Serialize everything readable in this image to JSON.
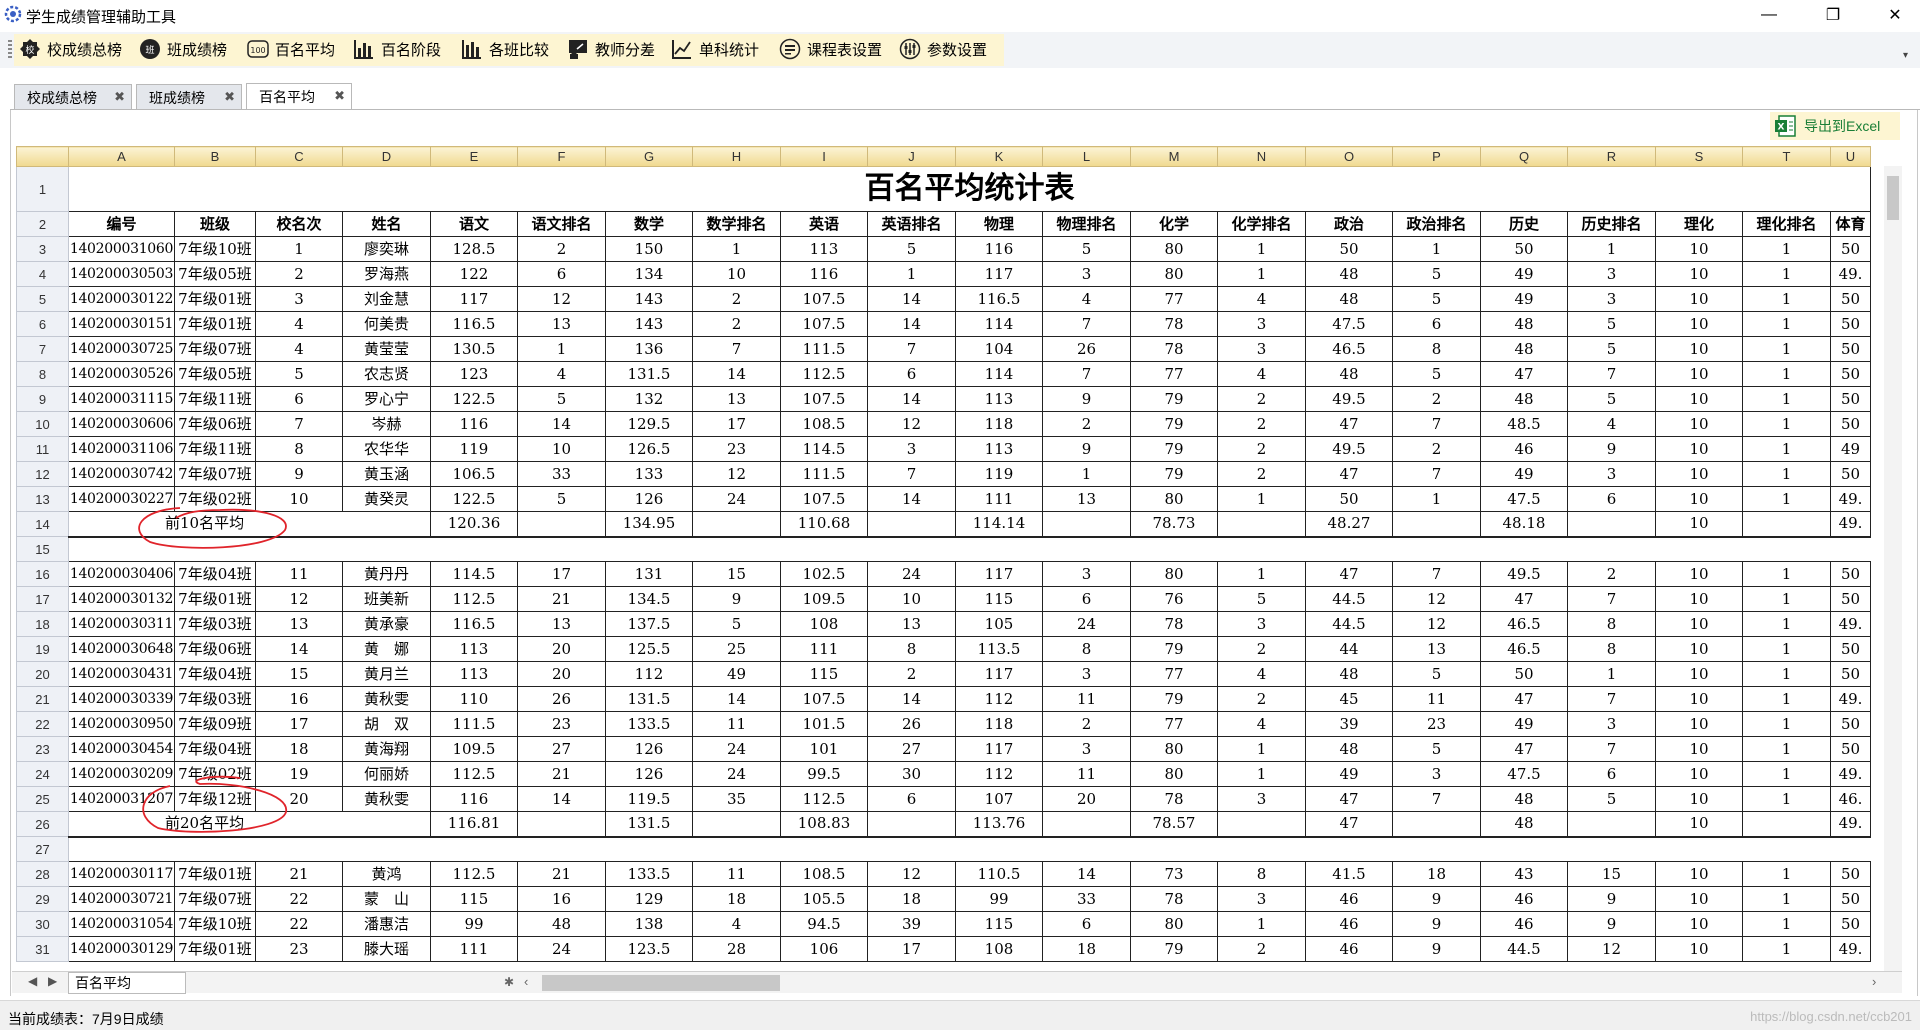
{
  "app": {
    "title": "学生成绩管理辅助工具",
    "window_controls": [
      "—",
      "❐",
      "✕"
    ]
  },
  "toolbar": {
    "buttons": [
      {
        "label": "校成绩总榜",
        "icon": "school-badge-icon"
      },
      {
        "label": "班成绩榜",
        "icon": "class-badge-icon"
      },
      {
        "label": "百名平均",
        "icon": "hundred-badge-icon"
      },
      {
        "label": "百名阶段",
        "icon": "bar-chart-icon"
      },
      {
        "label": "各班比较",
        "icon": "bar-chart-icon"
      },
      {
        "label": "教师分差",
        "icon": "teacher-icon"
      },
      {
        "label": "单科统计",
        "icon": "line-chart-icon"
      },
      {
        "label": "课程表设置",
        "icon": "schedule-icon"
      },
      {
        "label": "参数设置",
        "icon": "sliders-icon"
      }
    ]
  },
  "tabs": [
    {
      "label": "校成绩总榜",
      "close": "✖",
      "active": false
    },
    {
      "label": "班成绩榜",
      "close": "✖",
      "active": false
    },
    {
      "label": "百名平均",
      "close": "✖",
      "active": true
    }
  ],
  "export_button": {
    "label": "导出到Excel"
  },
  "sheet": {
    "column_letters": [
      "A",
      "B",
      "C",
      "D",
      "E",
      "F",
      "G",
      "H",
      "I",
      "J",
      "K",
      "L",
      "M",
      "N",
      "O",
      "P",
      "Q",
      "R",
      "S",
      "T",
      "U"
    ],
    "title": "百名平均统计表",
    "headers": [
      "编号",
      "班级",
      "校名次",
      "姓名",
      "语文",
      "语文排名",
      "数学",
      "数学排名",
      "英语",
      "英语排名",
      "物理",
      "物理排名",
      "化学",
      "化学排名",
      "政治",
      "政治排名",
      "历史",
      "历史排名",
      "理化",
      "理化排名",
      "体育"
    ],
    "group1": [
      [
        "140200031060",
        "7年级10班",
        "1",
        "廖奕琳",
        "128.5",
        "2",
        "150",
        "1",
        "113",
        "5",
        "116",
        "5",
        "80",
        "1",
        "50",
        "1",
        "50",
        "1",
        "10",
        "1",
        "50"
      ],
      [
        "140200030503",
        "7年级05班",
        "2",
        "罗海燕",
        "122",
        "6",
        "134",
        "10",
        "116",
        "1",
        "117",
        "3",
        "80",
        "1",
        "48",
        "5",
        "49",
        "3",
        "10",
        "1",
        "49."
      ],
      [
        "140200030122",
        "7年级01班",
        "3",
        "刘金慧",
        "117",
        "12",
        "143",
        "2",
        "107.5",
        "14",
        "116.5",
        "4",
        "77",
        "4",
        "48",
        "5",
        "49",
        "3",
        "10",
        "1",
        "50"
      ],
      [
        "140200030151",
        "7年级01班",
        "4",
        "何美贵",
        "116.5",
        "13",
        "143",
        "2",
        "107.5",
        "14",
        "114",
        "7",
        "78",
        "3",
        "47.5",
        "6",
        "48",
        "5",
        "10",
        "1",
        "50"
      ],
      [
        "140200030725",
        "7年级07班",
        "4",
        "黄莹莹",
        "130.5",
        "1",
        "136",
        "7",
        "111.5",
        "7",
        "104",
        "26",
        "78",
        "3",
        "46.5",
        "8",
        "48",
        "5",
        "10",
        "1",
        "50"
      ],
      [
        "140200030526",
        "7年级05班",
        "5",
        "农志贤",
        "123",
        "4",
        "131.5",
        "14",
        "112.5",
        "6",
        "114",
        "7",
        "77",
        "4",
        "48",
        "5",
        "47",
        "7",
        "10",
        "1",
        "50"
      ],
      [
        "140200031115",
        "7年级11班",
        "6",
        "罗心宁",
        "122.5",
        "5",
        "132",
        "13",
        "107.5",
        "14",
        "113",
        "9",
        "79",
        "2",
        "49.5",
        "2",
        "48",
        "5",
        "10",
        "1",
        "50"
      ],
      [
        "140200030606",
        "7年级06班",
        "7",
        "岑赫",
        "116",
        "14",
        "129.5",
        "17",
        "108.5",
        "12",
        "118",
        "2",
        "79",
        "2",
        "47",
        "7",
        "48.5",
        "4",
        "10",
        "1",
        "50"
      ],
      [
        "140200031106",
        "7年级11班",
        "8",
        "农华华",
        "119",
        "10",
        "126.5",
        "23",
        "114.5",
        "3",
        "113",
        "9",
        "79",
        "2",
        "49.5",
        "2",
        "46",
        "9",
        "10",
        "1",
        "49"
      ],
      [
        "140200030742",
        "7年级07班",
        "9",
        "黄玉涵",
        "106.5",
        "33",
        "133",
        "12",
        "111.5",
        "7",
        "119",
        "1",
        "79",
        "2",
        "47",
        "7",
        "49",
        "3",
        "10",
        "1",
        "50"
      ],
      [
        "140200030227",
        "7年级02班",
        "10",
        "黄癸灵",
        "122.5",
        "5",
        "126",
        "24",
        "107.5",
        "14",
        "111",
        "13",
        "80",
        "1",
        "50",
        "1",
        "47.5",
        "6",
        "10",
        "1",
        "49."
      ]
    ],
    "avg1": {
      "label": "前10名平均",
      "values": [
        "120.36",
        "",
        "134.95",
        "",
        "110.68",
        "",
        "114.14",
        "",
        "78.73",
        "",
        "48.27",
        "",
        "48.18",
        "",
        "10",
        "",
        "49."
      ]
    },
    "group2": [
      [
        "140200030406",
        "7年级04班",
        "11",
        "黄丹丹",
        "114.5",
        "17",
        "131",
        "15",
        "102.5",
        "24",
        "117",
        "3",
        "80",
        "1",
        "47",
        "7",
        "49.5",
        "2",
        "10",
        "1",
        "50"
      ],
      [
        "140200030132",
        "7年级01班",
        "12",
        "班美新",
        "112.5",
        "21",
        "134.5",
        "9",
        "109.5",
        "10",
        "115",
        "6",
        "76",
        "5",
        "44.5",
        "12",
        "47",
        "7",
        "10",
        "1",
        "50"
      ],
      [
        "140200030311",
        "7年级03班",
        "13",
        "黄承豪",
        "116.5",
        "13",
        "137.5",
        "5",
        "108",
        "13",
        "105",
        "24",
        "78",
        "3",
        "44.5",
        "12",
        "46.5",
        "8",
        "10",
        "1",
        "49."
      ],
      [
        "140200030648",
        "7年级06班",
        "14",
        "黄　娜",
        "113",
        "20",
        "125.5",
        "25",
        "111",
        "8",
        "113.5",
        "8",
        "79",
        "2",
        "44",
        "13",
        "46.5",
        "8",
        "10",
        "1",
        "50"
      ],
      [
        "140200030431",
        "7年级04班",
        "15",
        "黄月兰",
        "113",
        "20",
        "112",
        "49",
        "115",
        "2",
        "117",
        "3",
        "77",
        "4",
        "48",
        "5",
        "50",
        "1",
        "10",
        "1",
        "50"
      ],
      [
        "140200030339",
        "7年级03班",
        "16",
        "黄秋雯",
        "110",
        "26",
        "131.5",
        "14",
        "107.5",
        "14",
        "112",
        "11",
        "79",
        "2",
        "45",
        "11",
        "47",
        "7",
        "10",
        "1",
        "49."
      ],
      [
        "140200030950",
        "7年级09班",
        "17",
        "胡　双",
        "111.5",
        "23",
        "133.5",
        "11",
        "101.5",
        "26",
        "118",
        "2",
        "77",
        "4",
        "39",
        "23",
        "49",
        "3",
        "10",
        "1",
        "50"
      ],
      [
        "140200030454",
        "7年级04班",
        "18",
        "黄海翔",
        "109.5",
        "27",
        "126",
        "24",
        "101",
        "27",
        "117",
        "3",
        "80",
        "1",
        "48",
        "5",
        "47",
        "7",
        "10",
        "1",
        "50"
      ],
      [
        "140200030209",
        "7年级02班",
        "19",
        "何丽娇",
        "112.5",
        "21",
        "126",
        "24",
        "99.5",
        "30",
        "112",
        "11",
        "80",
        "1",
        "49",
        "3",
        "47.5",
        "6",
        "10",
        "1",
        "49."
      ],
      [
        "140200031207",
        "7年级12班",
        "20",
        "黄秋雯",
        "116",
        "14",
        "119.5",
        "35",
        "112.5",
        "6",
        "107",
        "20",
        "78",
        "3",
        "47",
        "7",
        "48",
        "5",
        "10",
        "1",
        "46."
      ]
    ],
    "avg2": {
      "label": "前20名平均",
      "values": [
        "116.81",
        "",
        "131.5",
        "",
        "108.83",
        "",
        "113.76",
        "",
        "78.57",
        "",
        "47",
        "",
        "48",
        "",
        "10",
        "",
        "49."
      ]
    },
    "group3": [
      [
        "140200030117",
        "7年级01班",
        "21",
        "黄鸿",
        "112.5",
        "21",
        "133.5",
        "11",
        "108.5",
        "12",
        "110.5",
        "14",
        "73",
        "8",
        "41.5",
        "18",
        "43",
        "15",
        "10",
        "1",
        "50"
      ],
      [
        "140200030721",
        "7年级07班",
        "22",
        "蒙　山",
        "115",
        "16",
        "129",
        "18",
        "105.5",
        "18",
        "99",
        "33",
        "78",
        "3",
        "46",
        "9",
        "46",
        "9",
        "10",
        "1",
        "50"
      ],
      [
        "140200031054",
        "7年级10班",
        "22",
        "潘惠洁",
        "99",
        "48",
        "138",
        "4",
        "94.5",
        "39",
        "115",
        "6",
        "80",
        "1",
        "46",
        "9",
        "46",
        "9",
        "10",
        "1",
        "50"
      ],
      [
        "140200030129",
        "7年级01班",
        "23",
        "滕大瑶",
        "111",
        "24",
        "123.5",
        "28",
        "106",
        "17",
        "108",
        "18",
        "79",
        "2",
        "46",
        "9",
        "44.5",
        "12",
        "10",
        "1",
        "49."
      ]
    ]
  },
  "sheet_tab": {
    "label": "百名平均"
  },
  "status": {
    "text": "当前成绩表：7月9日成绩",
    "watermark": "https://blog.csdn.net/ccb201"
  }
}
